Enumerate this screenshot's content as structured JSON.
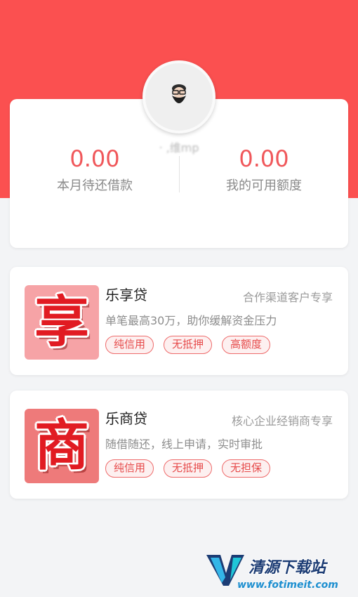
{
  "summary": {
    "username": "‧ ,维mp",
    "monthly_due": {
      "value": "0.00",
      "label": "本月待还借款"
    },
    "available_limit": {
      "value": "0.00",
      "label": "我的可用额度"
    }
  },
  "products": [
    {
      "logo_char": "享",
      "name": "乐享贷",
      "tag": "合作渠道客户专享",
      "desc": "单笔最高30万，助你缓解资金压力",
      "badges": [
        "纯信用",
        "无抵押",
        "高额度"
      ]
    },
    {
      "logo_char": "商",
      "name": "乐商贷",
      "tag": "核心企业经销商专享",
      "desc": "随借随还，线上申请，实时审批",
      "badges": [
        "纯信用",
        "无抵押",
        "无担保"
      ]
    }
  ],
  "watermark": {
    "title": "清源下载站",
    "url": "www.fotimeit.com"
  },
  "colors": {
    "brand_red": "#fb5050",
    "amount_red": "#f0575a",
    "background": "#f3f4f6"
  },
  "icons": {
    "avatar": "user-avatar-icon",
    "watermark_logo": "watermark-logo-icon"
  }
}
